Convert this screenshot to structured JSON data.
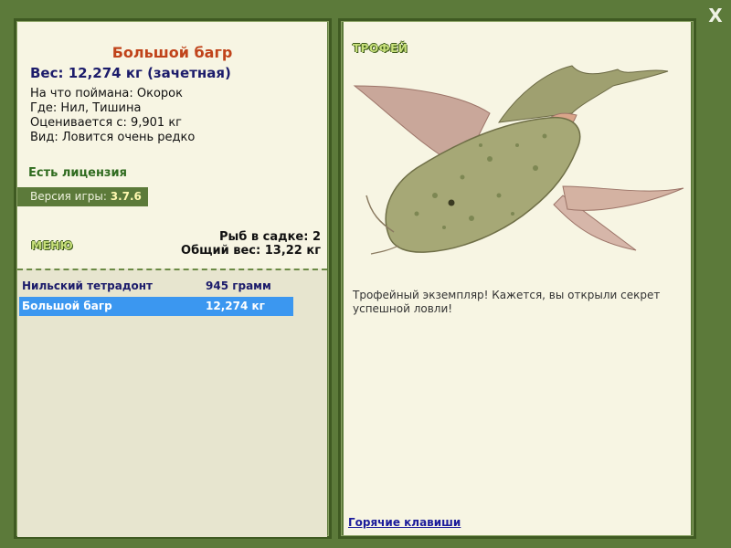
{
  "window": {
    "close_glyph": "X"
  },
  "fish": {
    "title": "Большой багр",
    "weight": "Вес: 12,274 кг (зачетная)",
    "bait": "На что поймана: Окорок",
    "location": "Где: Нил, Тишина",
    "value": "Оценивается с: 9,901 кг",
    "rarity": "Вид: Ловится очень редко"
  },
  "license": "Есть лицензия",
  "version": {
    "label": "Версия игры: ",
    "number": "3.7.6"
  },
  "menu_label": "МЕНЮ",
  "keepnet": {
    "count": "Рыб в садке: 2",
    "total_weight": "Общий вес: 13,22 кг",
    "rows": [
      {
        "name": "Нильский тетрадонт",
        "weight": "945 грамм"
      },
      {
        "name": "Большой багр",
        "weight": "12,274 кг"
      }
    ]
  },
  "trophy": {
    "label": "ТРОФЕЙ",
    "description": "Трофейный экземпляр! Кажется, вы открыли секрет успешной ловли!",
    "fish_image": "catfish-trophy-image"
  },
  "hotkeys_link": "Горячие клавиши",
  "colors": {
    "frame": "#5c7a3a",
    "panel_bg": "#f7f5e3",
    "title": "#c0431a",
    "selected_row": "#3b97f0",
    "license": "#2f6b1f"
  }
}
